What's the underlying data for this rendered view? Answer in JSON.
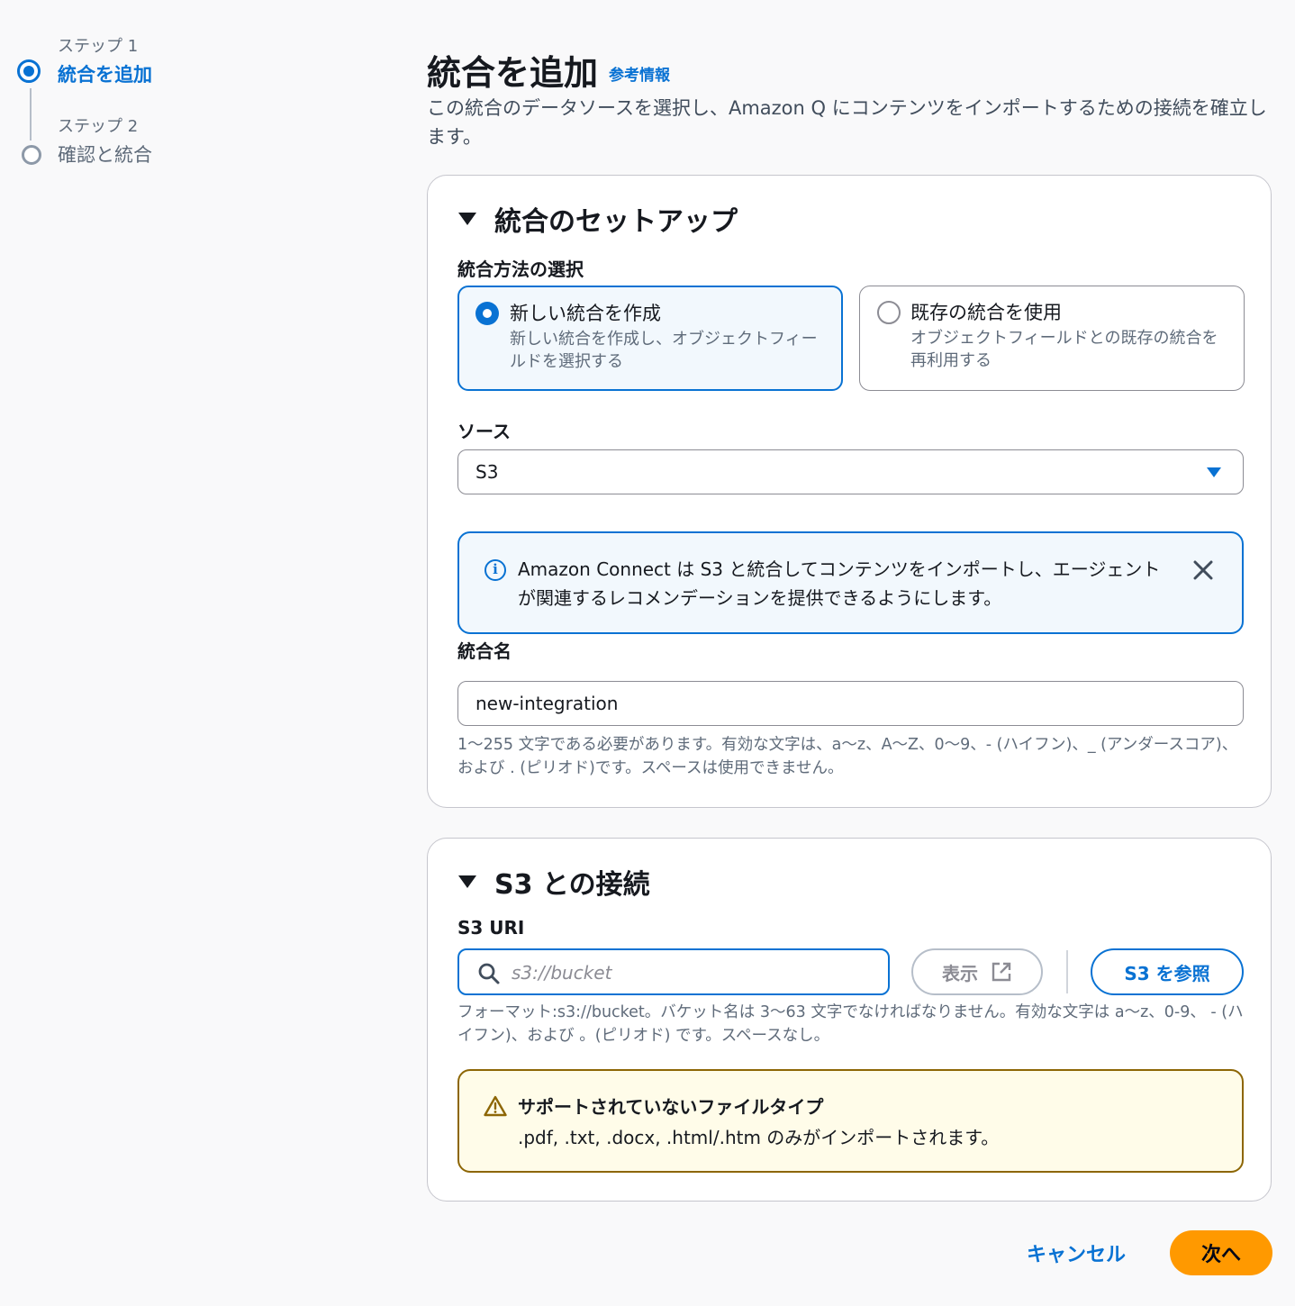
{
  "stepper": {
    "steps": [
      {
        "caption": "ステップ 1",
        "title": "統合を追加"
      },
      {
        "caption": "ステップ 2",
        "title": "確認と統合"
      }
    ]
  },
  "header": {
    "title": "統合を追加",
    "info_link": "参考情報",
    "description": "この統合のデータソースを選択し、Amazon Q にコンテンツをインポートするための接続を確立します。"
  },
  "setup_panel": {
    "title": "統合のセットアップ",
    "method_label": "統合方法の選択",
    "options": [
      {
        "title": "新しい統合を作成",
        "description": "新しい統合を作成し、オブジェクトフィールドを選択する",
        "selected": true
      },
      {
        "title": "既存の統合を使用",
        "description": "オブジェクトフィールドとの既存の統合を再利用する",
        "selected": false
      }
    ],
    "source_label": "ソース",
    "source_value": "S3",
    "info_alert": "Amazon Connect は S3 と統合してコンテンツをインポートし、エージェントが関連するレコメンデーションを提供できるようにします。",
    "name_label": "統合名",
    "name_value": "new-integration",
    "name_hint": "1〜255 文字である必要があります。有効な文字は、a〜z、A〜Z、0〜9、- (ハイフン)、_ (アンダースコア)、および . (ピリオド)です。スペースは使用できません。"
  },
  "s3_panel": {
    "title": "S3 との接続",
    "uri_label": "S3 URI",
    "uri_placeholder": "s3://bucket",
    "uri_value": "",
    "view_button": "表示",
    "browse_button": "S3 を参照",
    "uri_hint": "フォーマット:s3://bucket。バケット名は 3〜63 文字でなければなりません。有効な文字は a〜z、0-9、 - (ハイフン)、および 。(ピリオド) です。スペースなし。",
    "warning_title": "サポートされていないファイルタイプ",
    "warning_text": ".pdf, .txt, .docx, .html/.htm のみがインポートされます。"
  },
  "footer": {
    "cancel": "キャンセル",
    "next": "次へ"
  },
  "colors": {
    "accent": "#0972d3",
    "primary_button": "#ff9900",
    "warning_border": "#8d6605",
    "info_bg": "#f2f8fd"
  },
  "icons": [
    "step-active-icon",
    "step-idle-icon",
    "caret-down-icon",
    "info-icon",
    "close-icon",
    "search-icon",
    "external-link-icon",
    "warning-icon"
  ]
}
